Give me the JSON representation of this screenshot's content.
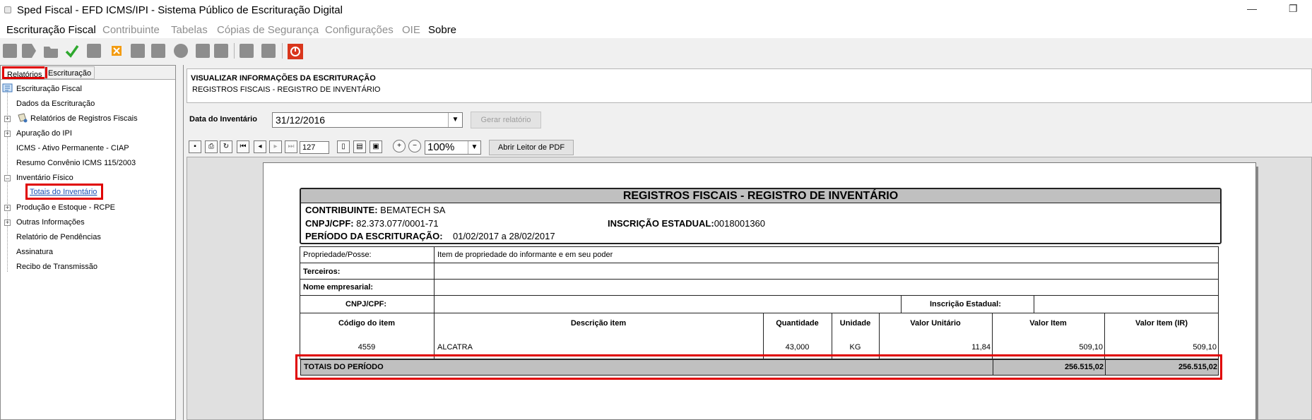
{
  "window": {
    "title": "Sped Fiscal - EFD ICMS/IPI - Sistema Público de Escrituração Digital",
    "minimize_glyph": "—",
    "restore_glyph": "❐"
  },
  "menu": [
    "Escrituração Fiscal",
    "Contribuinte",
    "Tabelas",
    "Cópias de Segurança",
    "Configurações",
    "OIE",
    "Sobre"
  ],
  "left_tabs": {
    "relatorios": "Relatórios",
    "escrituracao": "Escrituração"
  },
  "tree": {
    "root": "Escrituração Fiscal",
    "items": [
      "Dados da Escrituração",
      "Relatórios de Registros Fiscais",
      "Apuração do IPI",
      "ICMS - Ativo Permanente - CIAP",
      "Resumo  Convênio ICMS 115/2003",
      "Inventário Físico",
      "Totais do Inventário",
      "Produção e Estoque - RCPE",
      "Outras Informações",
      "Relatório de Pendências",
      "Assinatura",
      "Recibo de Transmissão"
    ]
  },
  "info": {
    "title": "VISUALIZAR INFORMAÇÕES DA ESCRITURAÇÃO",
    "subtitle": "REGISTROS FISCAIS - REGISTRO DE INVENTÁRIO"
  },
  "filter": {
    "date_label": "Data do Inventário",
    "date_value": "31/12/2016",
    "generate_button": "Gerar relatório"
  },
  "viewer": {
    "page": "127",
    "zoom": "100%",
    "open_pdf_button": "Abrir Leitor de PDF"
  },
  "report": {
    "title": "REGISTROS FISCAIS - REGISTRO DE INVENTÁRIO",
    "contribuinte_label": "CONTRIBUINTE:",
    "contribuinte_value": "BEMATECH SA",
    "cnpj_label": "CNPJ/CPF:",
    "cnpj_value": "82.373.077/0001-71",
    "ie_label": "INSCRIÇÃO ESTADUAL:",
    "ie_value": "0018001360",
    "periodo_label": "PERÍODO DA ESCRITURAÇÃO:",
    "periodo_value": "01/02/2017 a 28/02/2017",
    "propriedade_label": "Propriedade/Posse:",
    "propriedade_value": "Item de propriedade do informante e em seu poder",
    "terceiros_label": "Terceiros:",
    "nome_label": "Nome empresarial:",
    "cnpj2_label": "CNPJ/CPF:",
    "ie2_label": "Inscrição Estadual:",
    "columns": [
      "Código do item",
      "Descrição item",
      "Quantidade",
      "Unidade",
      "Valor Unitário",
      "Valor Item",
      "Valor Item (IR)"
    ],
    "row": [
      "4559",
      "ALCATRA",
      "43,000",
      "KG",
      "11,84",
      "509,10",
      "509,10"
    ],
    "total_label": "TOTAIS DO PERÍODO",
    "total_valor": "256.515,02",
    "total_valor_ir": "256.515,02"
  }
}
